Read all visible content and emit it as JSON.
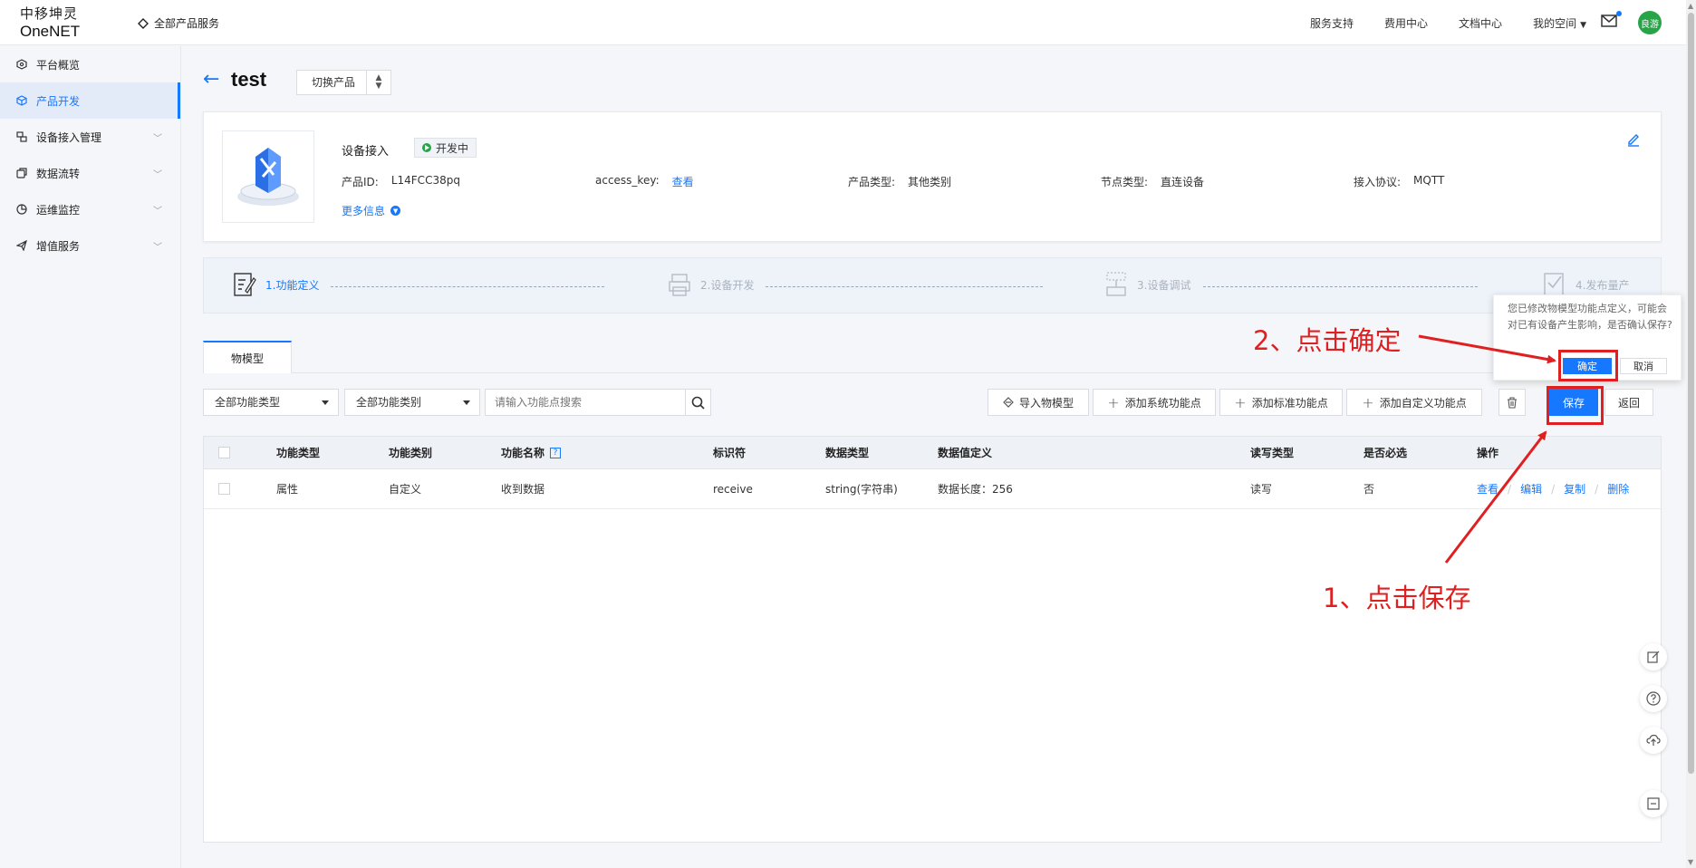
{
  "topbar": {
    "logo_cn": "中移坤灵",
    "logo_en": "OneNET",
    "all_products": "全部产品服务",
    "links": [
      "服务支持",
      "费用中心",
      "文档中心",
      "我的空间"
    ],
    "avatar_text": "良游"
  },
  "sidebar": {
    "items": [
      {
        "label": "平台概览",
        "icon": "overview-icon"
      },
      {
        "label": "产品开发",
        "icon": "cube-icon",
        "active": true
      },
      {
        "label": "设备接入管理",
        "icon": "device-icon"
      },
      {
        "label": "数据流转",
        "icon": "flow-icon"
      },
      {
        "label": "运维监控",
        "icon": "monitor-icon"
      },
      {
        "label": "增值服务",
        "icon": "plane-icon"
      }
    ]
  },
  "header": {
    "title": "test",
    "switch_label": "切换产品"
  },
  "product": {
    "section_title": "设备接入",
    "status": "开发中",
    "fields": {
      "product_id_label": "产品ID:",
      "product_id": "L14FCC38pq",
      "access_key_label": "access_key:",
      "access_key_link": "查看",
      "type_label": "产品类型:",
      "type": "其他类别",
      "node_label": "节点类型:",
      "node": "直连设备",
      "protocol_label": "接入协议:",
      "protocol": "MQTT"
    },
    "more_info": "更多信息"
  },
  "steps": [
    {
      "label": "1.功能定义",
      "active": true
    },
    {
      "label": "2.设备开发",
      "active": false
    },
    {
      "label": "3.设备调试",
      "active": false
    },
    {
      "label": "4.发布量产",
      "active": false
    }
  ],
  "tabs": {
    "model": "物模型"
  },
  "toolbar": {
    "filter_type": "全部功能类型",
    "filter_category": "全部功能类别",
    "search_placeholder": "请输入功能点搜索",
    "import": "导入物模型",
    "add_system": "添加系统功能点",
    "add_standard": "添加标准功能点",
    "add_custom": "添加自定义功能点",
    "save": "保存",
    "back": "返回"
  },
  "table": {
    "headers": [
      "功能类型",
      "功能类别",
      "功能名称",
      "标识符",
      "数据类型",
      "数据值定义",
      "读写类型",
      "是否必选",
      "操作"
    ],
    "rows": [
      {
        "type": "属性",
        "category": "自定义",
        "name": "收到数据",
        "identifier": "receive",
        "data_type": "string(字符串)",
        "definition": "数据长度：256",
        "rw": "读写",
        "required": "否"
      }
    ],
    "ops": [
      "查看",
      "编辑",
      "复制",
      "删除"
    ]
  },
  "popconfirm": {
    "text": "您已修改物模型功能点定义，可能会对已有设备产生影响，是否确认保存?",
    "ok": "确定",
    "cancel": "取消"
  },
  "annotations": {
    "step1": "1、点击保存",
    "step2": "2、点击确定"
  },
  "colors": {
    "accent": "#1677ff",
    "annotation": "#e02020",
    "status_green": "#27a348"
  }
}
